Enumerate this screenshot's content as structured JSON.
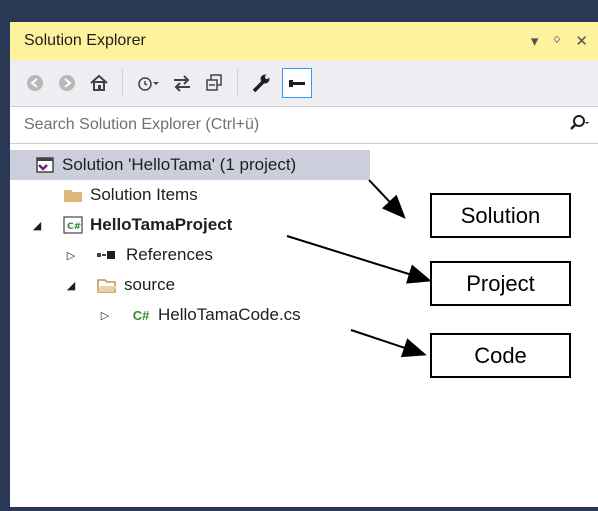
{
  "window": {
    "title": "Solution Explorer",
    "controls": [
      "▾",
      "ᛜ",
      "✕"
    ]
  },
  "toolbar": {
    "buttons": [
      "back",
      "forward",
      "home",
      "history",
      "sync",
      "collapse-all",
      "properties",
      "pin-active"
    ]
  },
  "search": {
    "placeholder": "Search Solution Explorer (Ctrl+ü)"
  },
  "tree": {
    "solution": "Solution 'HelloTama' (1 project)",
    "solution_items": "Solution Items",
    "project": "HelloTamaProject",
    "references": "References",
    "source": "source",
    "code_file": "HelloTamaCode.cs"
  },
  "callouts": {
    "solution": "Solution",
    "project": "Project",
    "code": "Code"
  },
  "colors": {
    "frame": "#293955",
    "title_active": "#fff29d",
    "selected_row": "#cccedb",
    "csharp_green": "#388a34",
    "solution_purple": "#68217a",
    "folder_yellow": "#dcb67a"
  }
}
